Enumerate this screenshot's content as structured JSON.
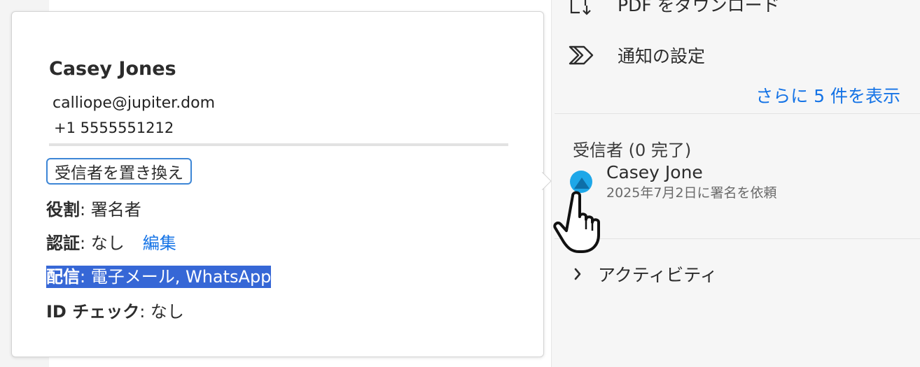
{
  "menu": {
    "download_label": "PDF をダウンロード",
    "notify_label": "通知の設定",
    "show_more": "さらに 5 件を表示"
  },
  "recipients": {
    "heading": "受信者 (0 完了)",
    "items": [
      {
        "name": "Casey Jone",
        "date": "2025年7月2日に署名を依頼",
        "avatar_color": "#1ea7e8"
      }
    ]
  },
  "activity": {
    "label": "アクティビティ"
  },
  "popover": {
    "name": "Casey Jones",
    "email": "calliope@jupiter.dom",
    "phone": "+1 5555551212",
    "replace_button": "受信者を置き換え",
    "role_label": "役割",
    "role_value": ": 署名者",
    "auth_label": "認証",
    "auth_value": ": なし",
    "edit_link": "編集",
    "delivery_label": "配信",
    "delivery_value": ": 電子メール, WhatsApp",
    "idcheck_label": "ID チェック",
    "idcheck_value": ": なし"
  },
  "colors": {
    "accent": "#1473e6",
    "selection": "#3667d6",
    "button_border": "#3d86d6"
  },
  "icons": {
    "download": "download-pdf-icon",
    "notify": "notification-settings-icon",
    "chevron": "chevron-right-icon",
    "cursor": "hand-cursor-icon"
  }
}
